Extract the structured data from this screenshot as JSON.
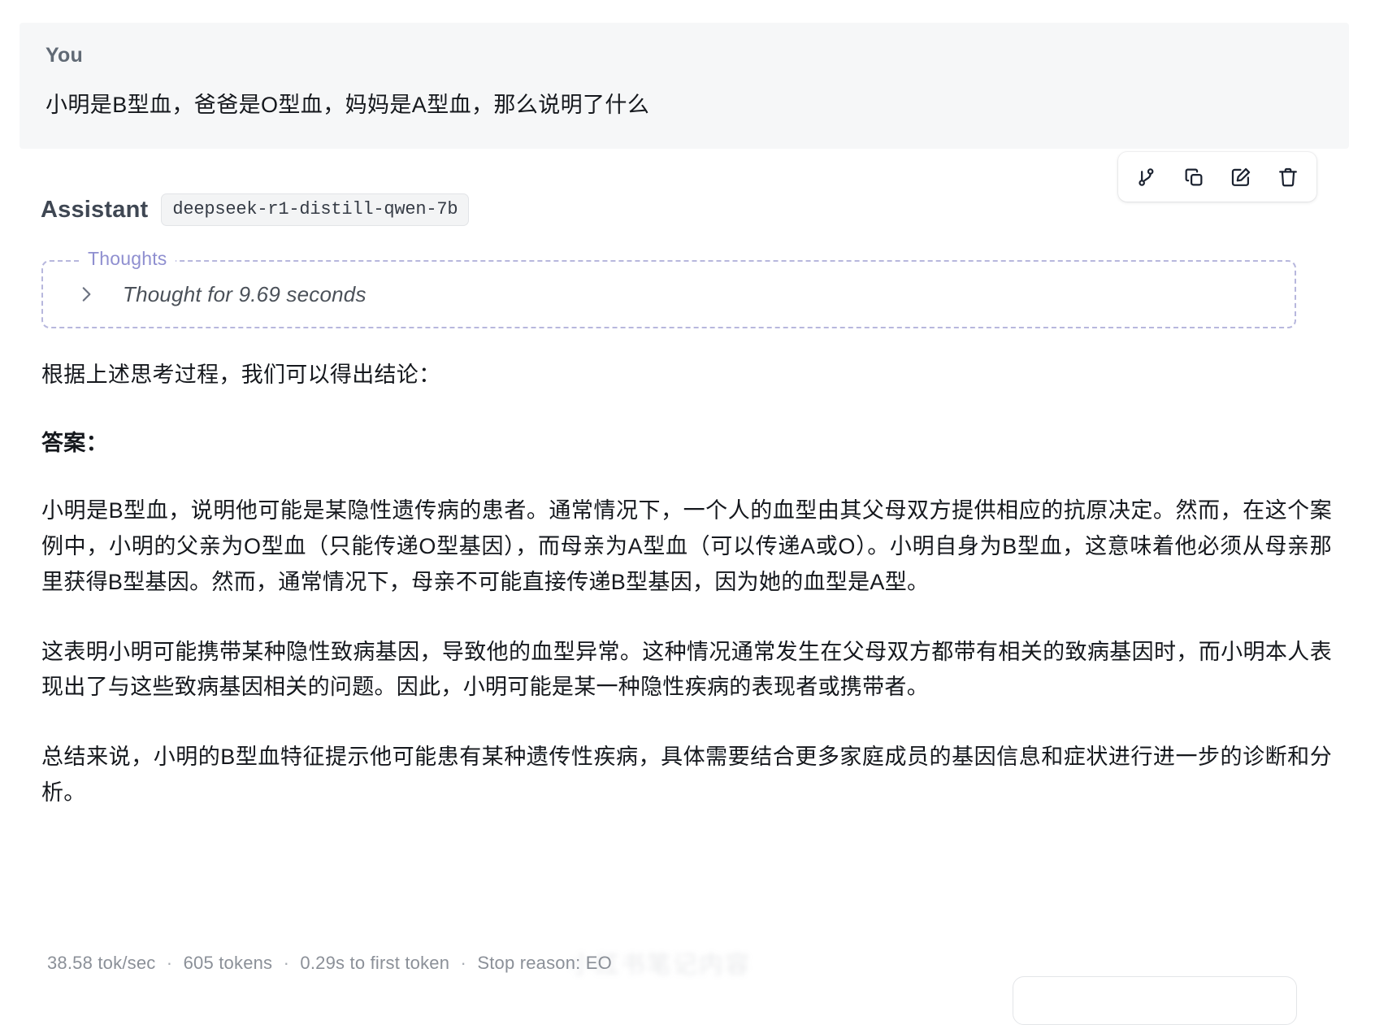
{
  "conversation": {
    "user": {
      "role_label": "You",
      "message": "小明是B型血，爸爸是O型血，妈妈是A型血，那么说明了什么"
    },
    "toolbar": {
      "branch_label": "branch-icon",
      "copy_label": "copy-icon",
      "edit_label": "edit-icon",
      "delete_label": "trash-icon"
    },
    "assistant": {
      "role_label": "Assistant",
      "model_badge": "deepseek-r1-distill-qwen-7b",
      "thoughts": {
        "legend": "Thoughts",
        "summary": "Thought for 9.69 seconds",
        "chevron": "chevron-right-icon",
        "expanded": false
      },
      "paragraphs": [
        "根据上述思考过程，我们可以得出结论：",
        "答案：",
        "小明是B型血，说明他可能是某隐性遗传病的患者。通常情况下，一个人的血型由其父母双方提供相应的抗原决定。然而，在这个案例中，小明的父亲为O型血（只能传递O型基因），而母亲为A型血（可以传递A或O）。小明自身为B型血，这意味着他必须从母亲那里获得B型基因。然而，通常情况下，母亲不可能直接传递B型基因，因为她的血型是A型。",
        "这表明小明可能携带某种隐性致病基因，导致他的血型异常。这种情况通常发生在父母双方都带有相关的致病基因时，而小明本人表现出了与这些致病基因相关的问题。因此，小明可能是某一种隐性疾病的表现者或携带者。",
        "总结来说，小明的B型血特征提示他可能患有某种遗传性疾病，具体需要结合更多家庭成员的基因信息和症状进行进一步的诊断和分析。"
      ],
      "stats": {
        "speed": "38.58 tok/sec",
        "tokens": "605 tokens",
        "ttft": "0.29s to first token",
        "stop_reason": "Stop reason: EO",
        "separator": "·"
      },
      "watermark": "小红书笔记内容"
    }
  },
  "colors": {
    "user_bubble_bg": "#f6f7f8",
    "thoughts_border": "#b7b7dd",
    "thoughts_legend": "#8f8fd0",
    "body_text": "#15181d",
    "muted_text": "#8b9098"
  }
}
